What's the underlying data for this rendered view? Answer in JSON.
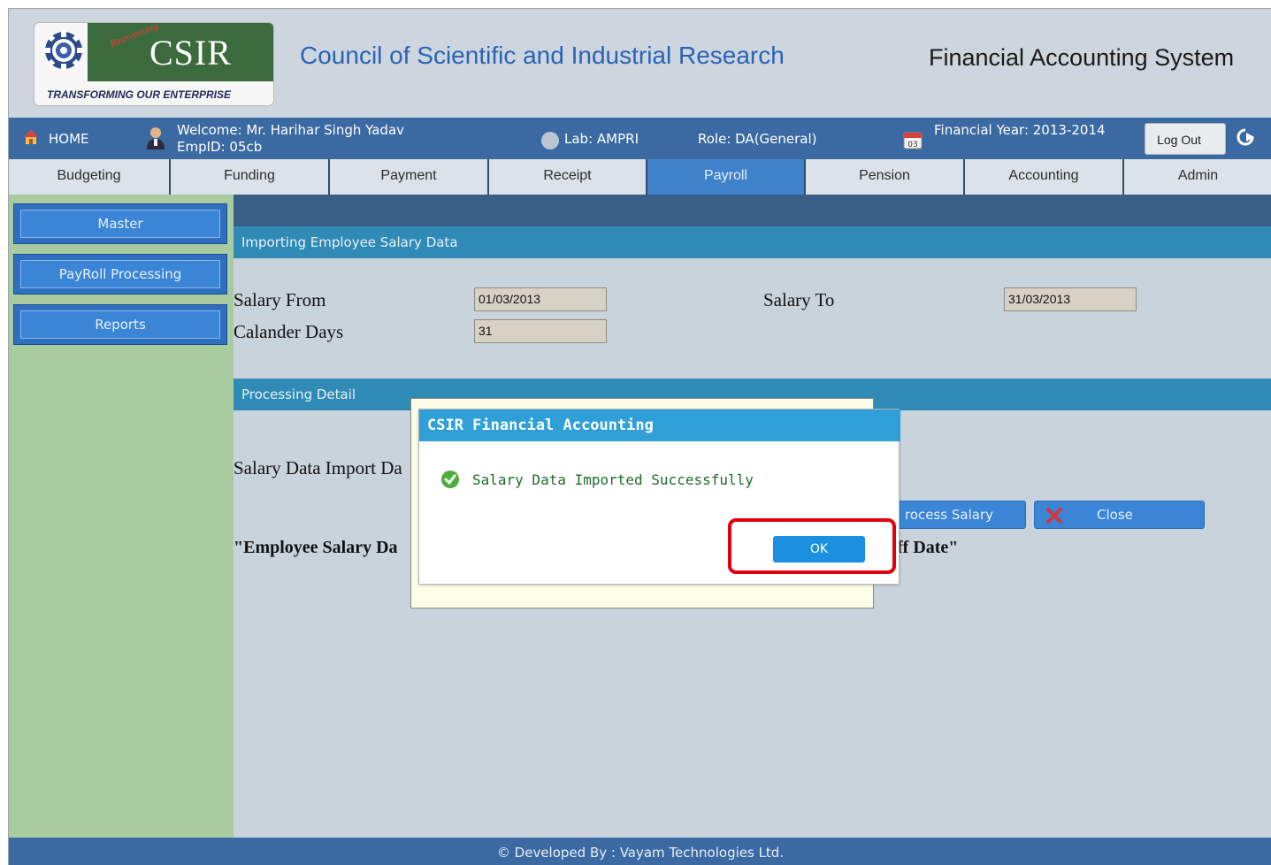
{
  "header": {
    "logo": {
      "reinventing": "Reinventing",
      "wordmark": "CSIR",
      "tagline": "TRANSFORMING OUR ENTERPRISE"
    },
    "org_title": "Council of Scientific and Industrial Research",
    "system_title": "Financial Accounting System"
  },
  "infobar": {
    "home": "HOME",
    "welcome": "Welcome: Mr. Harihar Singh Yadav",
    "empid": "EmpID: 05cb",
    "lab": "Lab: AMPRI",
    "role": "Role: DA(General)",
    "calendar_day": "03",
    "financial_year": "Financial Year: 2013-2014",
    "logout": "Log Out"
  },
  "tabs": [
    {
      "label": "Budgeting"
    },
    {
      "label": "Funding"
    },
    {
      "label": "Payment"
    },
    {
      "label": "Receipt"
    },
    {
      "label": "Payroll",
      "active": true
    },
    {
      "label": "Pension"
    },
    {
      "label": "Accounting"
    },
    {
      "label": "Admin"
    }
  ],
  "sidebar": {
    "items": [
      {
        "label": "Master"
      },
      {
        "label": "PayRoll Processing"
      },
      {
        "label": "Reports"
      }
    ]
  },
  "main": {
    "section1_title": "Importing Employee Salary Data",
    "salary_from_label": "Salary From",
    "salary_from_value": "01/03/2013",
    "salary_to_label": "Salary To",
    "salary_to_value": "31/03/2013",
    "calendar_days_label": "Calander Days",
    "calendar_days_value": "31",
    "section2_title": "Processing Detail",
    "import_date_label": "Salary Data Import Da",
    "process_salary_btn": "rocess Salary",
    "close_btn": "Close",
    "note_left": "\"Employee Salary Da",
    "note_right": "ff Date\""
  },
  "dialog": {
    "title": "CSIR Financial Accounting",
    "message": "Salary Data Imported Successfully",
    "ok": "OK"
  },
  "footer": {
    "text": "© Developed By : Vayam Technologies Ltd."
  },
  "colors": {
    "infobar": "#3b6aa3",
    "active_tab": "#3f82c9",
    "sidebar": "#a8cba0",
    "section_header": "#2f8ab6",
    "dialog_title": "#2f9fd8",
    "highlight": "#e00010"
  }
}
